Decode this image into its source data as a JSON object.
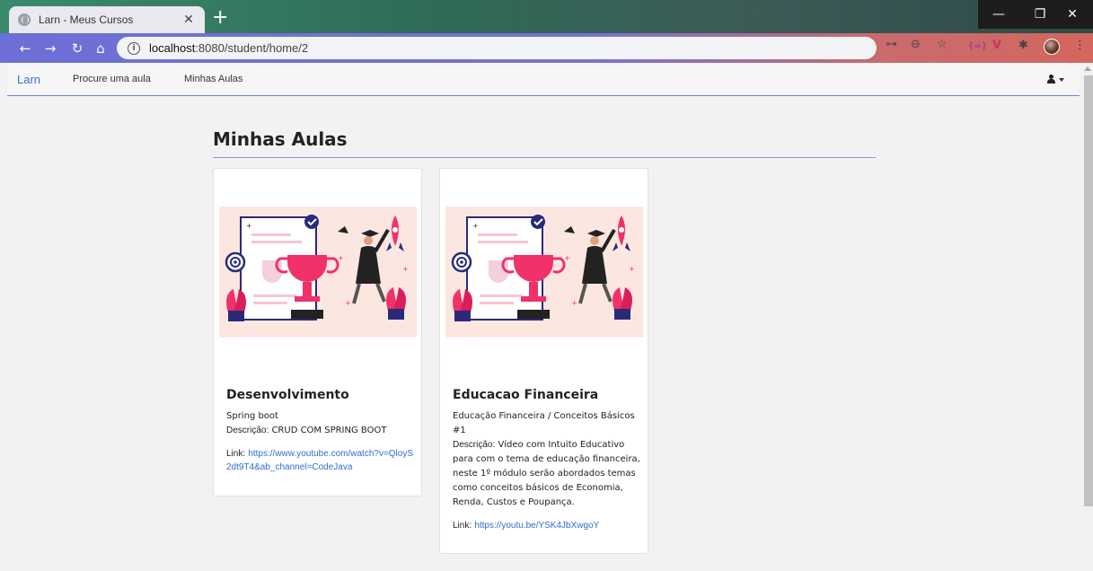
{
  "browser": {
    "tab_title": "Larn - Meus Cursos",
    "tab_close": "✕",
    "new_tab": "+",
    "url_host": "localhost",
    "url_path": ":8080/student/home/2",
    "win_min": "—",
    "win_max": "❐",
    "win_close": "✕",
    "toolbar_icons": [
      "key-icon",
      "zoom-icon",
      "star-icon",
      "extension-icon",
      "vivaldi-icon",
      "puzzle-icon",
      "profile-avatar",
      "menu-icon"
    ],
    "extension_label": "{=}",
    "menu_glyph": "⋮"
  },
  "appnav": {
    "brand": "Larn",
    "links": [
      "Procure uma aula",
      "Minhas Aulas"
    ]
  },
  "page": {
    "title": "Minhas Aulas"
  },
  "cards": [
    {
      "title": "Desenvolvimento",
      "subtitle": "Spring boot",
      "desc_label": "Descrição:",
      "desc": "CRUD COM SPRING BOOT",
      "link_label": "Link:",
      "link": "https://www.youtube.com/watch?v=QloyS2dt9T4&ab_channel=CodeJava"
    },
    {
      "title": "Educacao Financeira",
      "subtitle": "Educação Financeira / Conceitos Básicos #1",
      "desc_label": "Descrição:",
      "desc": "Vídeo com Intuito Educativo para com o tema de educação financeira, neste 1º módulo serão abordados temas como conceitos básicos de Economia, Renda, Custos e Poupança.",
      "link_label": "Link:",
      "link": "https://youtu.be/YSK4JbXwgoY"
    }
  ],
  "colors": {
    "brand": "#3b6fd6",
    "link": "#2f6fd0",
    "nav_rule": "#6f86d6",
    "illustration_bg": "#fbe7e0",
    "trophy": "#f0316a"
  }
}
